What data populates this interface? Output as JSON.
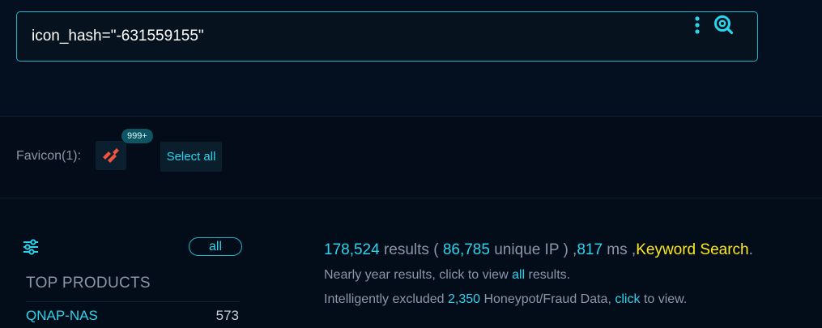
{
  "search": {
    "value": "icon_hash=\"-631559155\""
  },
  "favicon": {
    "label": "Favicon(1):",
    "badge": "999+",
    "select_all_label": "Select all"
  },
  "sidebar": {
    "all_label": "all",
    "top_products_title": "TOP PRODUCTS",
    "products": [
      {
        "name": "QNAP-NAS",
        "count": "573"
      }
    ]
  },
  "results": {
    "count": "178,524",
    "results_word": " results ( ",
    "unique_ip": "86,785",
    "unique_ip_word": " unique IP ) ,",
    "ms_value": "817",
    "ms_word": " ms ,",
    "keyword_search": "Keyword Search",
    "period": ".",
    "year_prefix": "Nearly year results, click to view ",
    "year_link": "all",
    "year_suffix": " results.",
    "excluded_prefix": "Intelligently excluded ",
    "excluded_count": "2,350",
    "excluded_middle": " Honeypot/Fraud Data, ",
    "excluded_link": "click",
    "excluded_suffix": " to view."
  },
  "colors": {
    "accent": "#2ad4ec",
    "keyword": "#ffe81a",
    "favicon_brand": "#f0543c"
  },
  "icons": {
    "more": "vertical-dots-icon",
    "search": "search-icon",
    "filter": "sliders-icon",
    "favicon": "favicon-logo-icon"
  }
}
